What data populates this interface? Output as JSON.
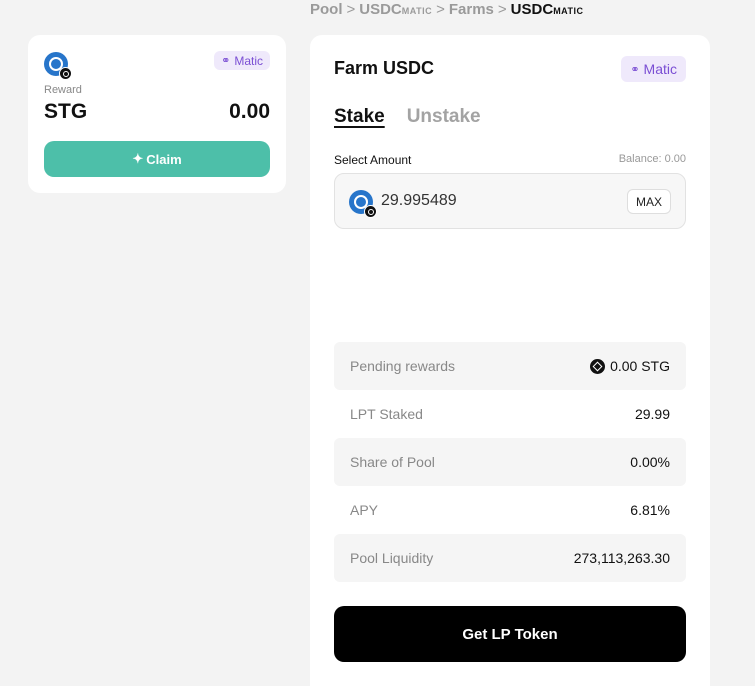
{
  "breadcrumb": {
    "items": [
      {
        "label": "Pool"
      },
      {
        "label": "USDC",
        "sub": "MATIC"
      },
      {
        "label": "Farms"
      },
      {
        "label": "USDC",
        "sub": "MATIC"
      }
    ],
    "separator": ">"
  },
  "reward_card": {
    "chain_chip": "Matic",
    "label": "Reward",
    "token": "STG",
    "amount": "0.00",
    "claim_label": "Claim",
    "claim_icon": "✦"
  },
  "farm_card": {
    "title": "Farm USDC",
    "chain_chip": "Matic",
    "tabs": [
      {
        "label": "Stake"
      },
      {
        "label": "Unstake"
      }
    ],
    "select_label": "Select Amount",
    "balance": "Balance: 0.00",
    "amount_value": "29.995489",
    "max_label": "MAX",
    "stats": [
      {
        "label": "Pending rewards",
        "value": "0.00 STG"
      },
      {
        "label": "LPT Staked",
        "value": "29.99"
      },
      {
        "label": "Share of Pool",
        "value": "0.00%"
      },
      {
        "label": "APY",
        "value": "6.81%"
      },
      {
        "label": "Pool Liquidity",
        "value": "273,113,263.30"
      }
    ],
    "cta_label": "Get LP Token"
  },
  "colors": {
    "accent_green": "#4dbfa9",
    "chip_purple": "#7b4fd4",
    "usdc_blue": "#2775ca"
  }
}
